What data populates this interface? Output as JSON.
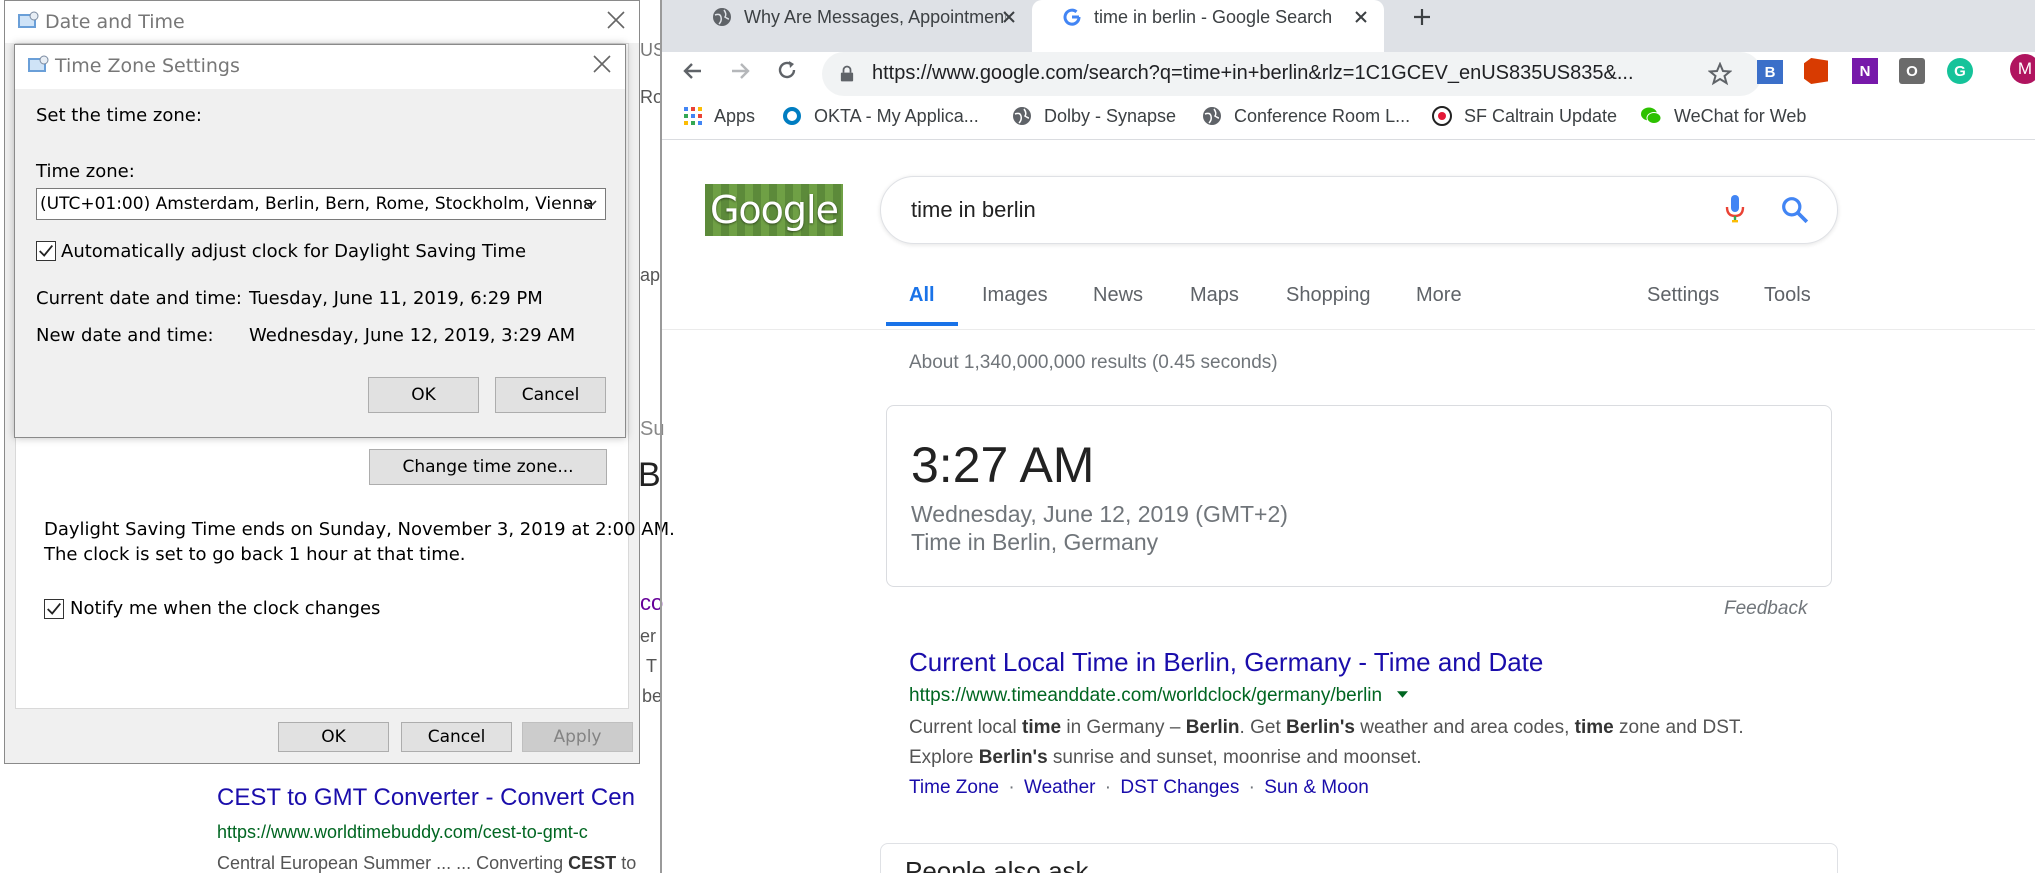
{
  "bg_results": {
    "title": "CEST to GMT Converter - Convert Cen",
    "url": "https://www.worldtimebuddy.com/cest-to-gmt-c",
    "snippet_pre": "Central European Summer ... ... Converting ",
    "snippet_bold": "CEST",
    "snippet_post": " to",
    "frag1": "US",
    "frag2": "Ro",
    "frag3": "ap",
    "frag4": "Su",
    "frag5": "B",
    "frag6": "co",
    "frag7": "er",
    "frag8": "T",
    "frag9": "be"
  },
  "datetime_dialog": {
    "title": "Date and Time",
    "change_tz_button": "Change time zone...",
    "dst_line1": "Daylight Saving Time ends on Sunday, November 3, 2019 at 2:00 AM.",
    "dst_line2": "The clock is set to go back 1 hour at that time.",
    "notify_label": "Notify me when the clock changes",
    "ok": "OK",
    "cancel": "Cancel",
    "apply": "Apply"
  },
  "tz_dialog": {
    "title": "Time Zone Settings",
    "heading": "Set the time zone:",
    "tz_label": "Time zone:",
    "tz_value": "(UTC+01:00) Amsterdam, Berlin, Bern, Rome, Stockholm, Vienna",
    "auto_dst_label": "Automatically adjust clock for Daylight Saving Time",
    "current_label": "Current date and time:",
    "current_value": "Tuesday, June 11, 2019, 6:29 PM",
    "new_label": "New date and time:",
    "new_value": "Wednesday, June 12, 2019, 3:29 AM",
    "ok": "OK",
    "cancel": "Cancel"
  },
  "browser": {
    "tabs": [
      {
        "title": "Why Are Messages, Appointment"
      },
      {
        "title": "time in berlin - Google Search"
      }
    ],
    "url": "https://www.google.com/search?q=time+in+berlin&rlz=1C1GCEV_enUS835US835&...",
    "bookmarks": [
      {
        "label": "Apps"
      },
      {
        "label": "OKTA -  My Applica..."
      },
      {
        "label": "Dolby - Synapse"
      },
      {
        "label": "Conference Room L..."
      },
      {
        "label": "SF Caltrain Update"
      },
      {
        "label": "WeChat for Web"
      }
    ],
    "profile_initial": "M",
    "ext_labels": {
      "onenote": "N",
      "office": "O",
      "grammarly": "G",
      "bi": "B"
    }
  },
  "google": {
    "logo": "Google",
    "query": "time in berlin",
    "nav": [
      "All",
      "Images",
      "News",
      "Maps",
      "Shopping",
      "More"
    ],
    "nav_right": [
      "Settings",
      "Tools"
    ],
    "stats": "About 1,340,000,000 results (0.45 seconds)",
    "time_card": {
      "time": "3:27 AM",
      "date": "Wednesday, June 12, 2019 (GMT+2)",
      "place": "Time in Berlin, Germany"
    },
    "feedback": "Feedback",
    "result": {
      "title": "Current Local Time in Berlin, Germany - Time and Date",
      "url": "https://www.timeanddate.com/worldclock/germany/berlin",
      "s1": "Current local ",
      "s1b": "time",
      "s2": " in Germany – ",
      "s2b": "Berlin",
      "s3": ". Get ",
      "s3b": "Berlin's",
      "s4": " weather and area codes, ",
      "s4b": "time",
      "s5": " zone and DST.",
      "l2a": "Explore ",
      "l2b": "Berlin's",
      "l2c": " sunrise and sunset, moonrise and moonset.",
      "sitelinks": [
        "Time Zone",
        "Weather",
        "DST Changes",
        "Sun & Moon"
      ],
      "sep": "·"
    },
    "paa": "People also ask"
  }
}
